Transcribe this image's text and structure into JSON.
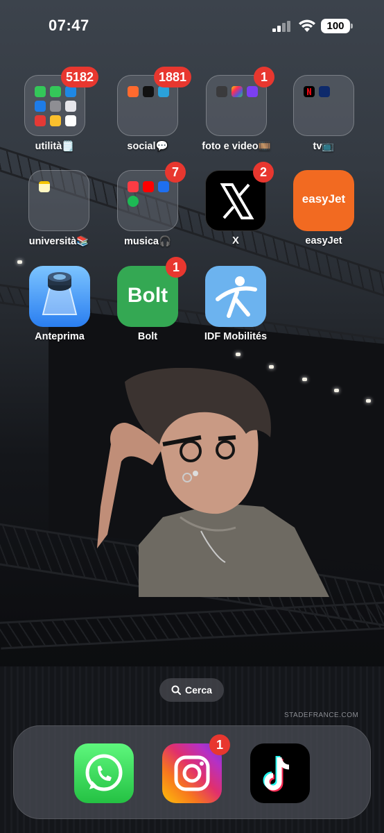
{
  "status_bar": {
    "time": "07:47",
    "battery": "100"
  },
  "apps": [
    {
      "id": "utilita",
      "label": "utilità🗒️",
      "badge": "5182",
      "type": "folder"
    },
    {
      "id": "social",
      "label": "social💬",
      "badge": "1881",
      "type": "folder"
    },
    {
      "id": "foto",
      "label": "foto e video🎞️",
      "badge": "1",
      "type": "folder"
    },
    {
      "id": "tv",
      "label": "tv📺",
      "badge": "",
      "type": "folder"
    },
    {
      "id": "universita",
      "label": "università📚",
      "badge": "",
      "type": "folder"
    },
    {
      "id": "musica",
      "label": "musica🎧",
      "badge": "7",
      "type": "folder"
    },
    {
      "id": "x",
      "label": "X",
      "badge": "2",
      "type": "app"
    },
    {
      "id": "easyjet",
      "label": "easyJet",
      "badge": "",
      "type": "app",
      "icon_text": "easyJet"
    },
    {
      "id": "anteprima",
      "label": "Anteprima",
      "badge": "",
      "type": "app"
    },
    {
      "id": "bolt",
      "label": "Bolt",
      "badge": "1",
      "type": "app",
      "icon_text": "Bolt"
    },
    {
      "id": "idf",
      "label": "IDF Mobilités",
      "badge": "",
      "type": "app"
    }
  ],
  "search": {
    "label": "Cerca"
  },
  "dock": [
    {
      "id": "whatsapp",
      "badge": ""
    },
    {
      "id": "instagram",
      "badge": "1"
    },
    {
      "id": "tiktok",
      "badge": ""
    }
  ],
  "wallpaper": {
    "sign_text": "STADEFRANCE.COM"
  },
  "colors": {
    "badge": "#e8372f",
    "easyjet": "#f26a21",
    "bolt": "#34a853",
    "whatsapp": "#25d366",
    "idf": "#6cb3ef"
  }
}
